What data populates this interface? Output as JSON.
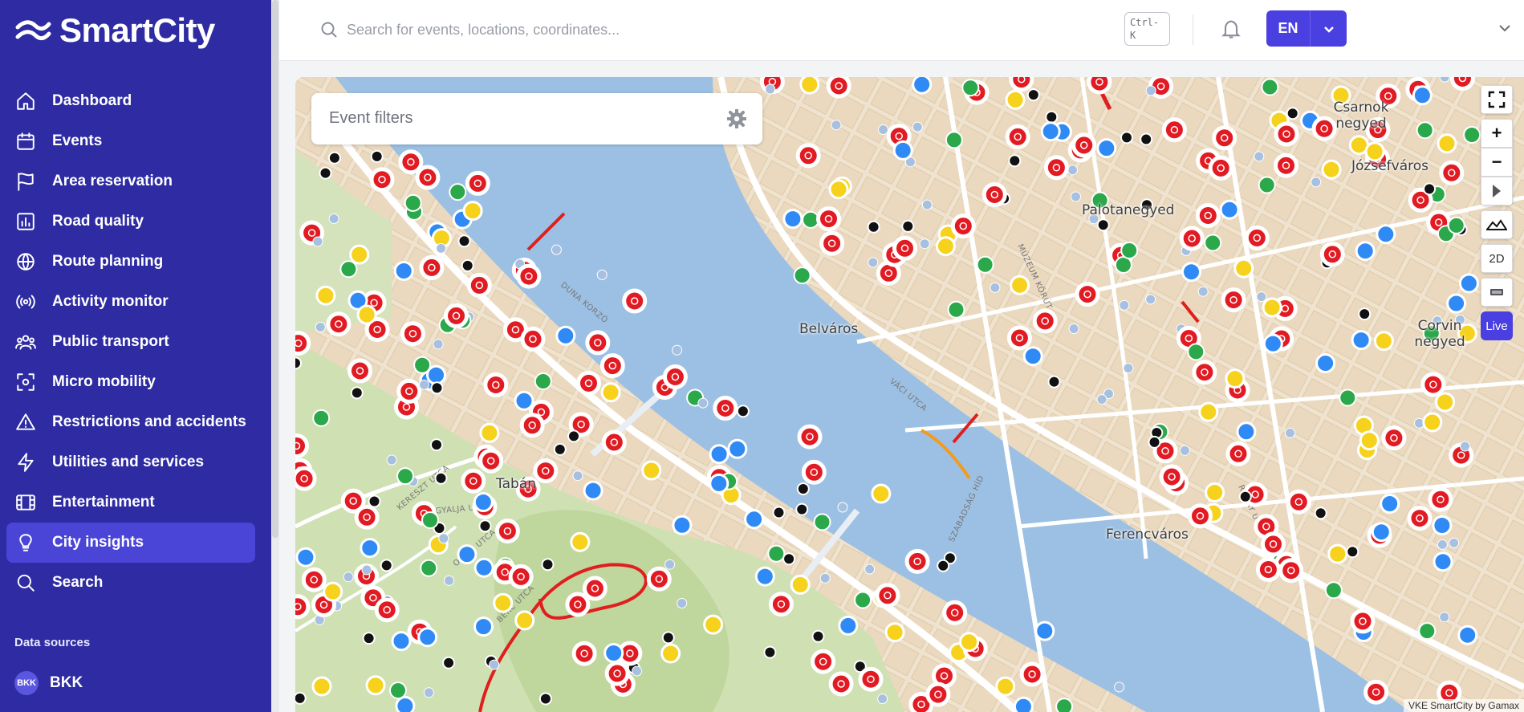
{
  "app": {
    "name": "SmartCity"
  },
  "sidebar": {
    "items": [
      {
        "label": "Dashboard",
        "icon": "home-icon"
      },
      {
        "label": "Events",
        "icon": "calendar-icon"
      },
      {
        "label": "Area reservation",
        "icon": "flag-icon"
      },
      {
        "label": "Road quality",
        "icon": "bar-chart-icon"
      },
      {
        "label": "Route planning",
        "icon": "globe-icon"
      },
      {
        "label": "Activity monitor",
        "icon": "broadcast-icon"
      },
      {
        "label": "Public transport",
        "icon": "users-icon"
      },
      {
        "label": "Micro mobility",
        "icon": "scan-icon"
      },
      {
        "label": "Restrictions and accidents",
        "icon": "warning-icon"
      },
      {
        "label": "Utilities and services",
        "icon": "lightning-icon"
      },
      {
        "label": "Entertainment",
        "icon": "film-icon"
      },
      {
        "label": "City insights",
        "icon": "lightbulb-icon",
        "active": true
      },
      {
        "label": "Search",
        "icon": "search-icon"
      }
    ],
    "data_sources_heading": "Data sources",
    "data_sources": [
      {
        "badge": "BKK",
        "label": "BKK"
      }
    ]
  },
  "topbar": {
    "search_placeholder": "Search for events, locations, coordinates...",
    "shortcut": "Ctrl-K",
    "language": "EN"
  },
  "map": {
    "filters_placeholder": "Event filters",
    "controls": {
      "mode_2d": "2D",
      "live": "Live"
    },
    "attribution": "VKE SmartCity by Gamax",
    "places": [
      "Belváros",
      "Tabán",
      "Palotanegyed",
      "Józsefváros",
      "Csarnok negyed",
      "Corvin negyed",
      "Ferencváros"
    ],
    "streets": [
      "DUNA KORZÓ",
      "VÁCI UTCA",
      "SZABADSÁG HÍD",
      "MÚZEUM KÖRÚT",
      "RÁDAY UTCA",
      "ORÓM UTCA",
      "BÉRC UTCA",
      "KERESZT UTCA",
      "HEGYALJA UTCA"
    ],
    "colors": {
      "water": "#9cc0e4",
      "land": "#efe5d3",
      "park": "#cfe0b3",
      "accent": "#4a3fe0"
    }
  }
}
